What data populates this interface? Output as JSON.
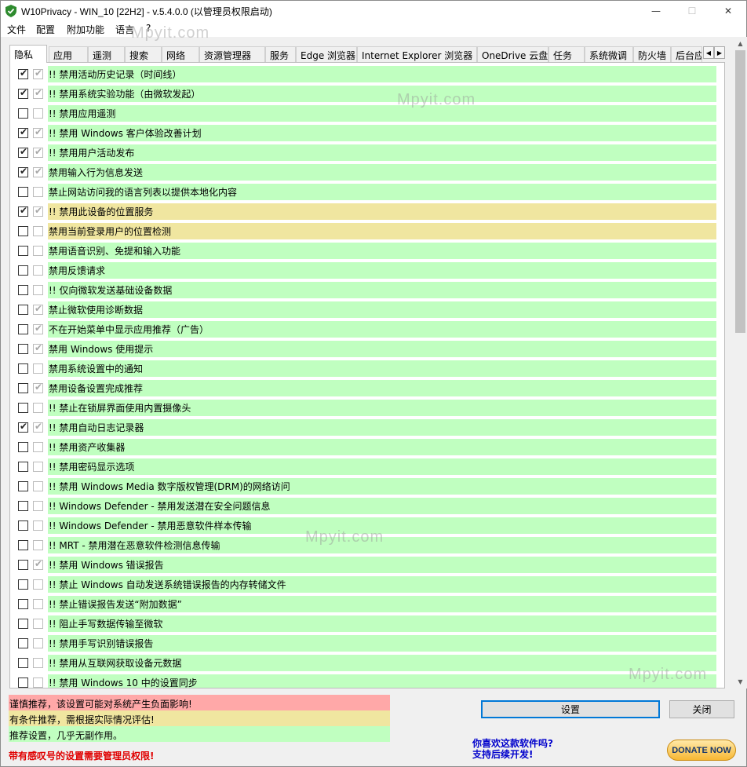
{
  "window": {
    "title": "W10Privacy - WIN_10 [22H2]  - v.5.4.0.0 (以管理员权限启动)",
    "minimize": "—",
    "maximize": "☐",
    "close": "✕"
  },
  "menu": [
    "文件",
    "配置",
    "附加功能",
    "语言",
    "?"
  ],
  "watermark": "Mpyit.com",
  "tabs": [
    {
      "label": "隐私",
      "active": true
    },
    {
      "label": "应用"
    },
    {
      "label": "遥测"
    },
    {
      "label": "搜索"
    },
    {
      "label": "网络"
    },
    {
      "label": "资源管理器"
    },
    {
      "label": "服务"
    },
    {
      "label": "Edge 浏览器"
    },
    {
      "label": "Internet Explorer 浏览器"
    },
    {
      "label": "OneDrive 云盘"
    },
    {
      "label": "任务"
    },
    {
      "label": "系统微调"
    },
    {
      "label": "防火墙"
    },
    {
      "label": "后台应"
    }
  ],
  "tab_scroll": {
    "left": "◀",
    "right": "▶"
  },
  "settings": [
    {
      "checked": true,
      "applied": true,
      "label": "!! 禁用活动历史记录（时间线）",
      "level": "green"
    },
    {
      "checked": true,
      "applied": true,
      "label": "!! 禁用系统实验功能（由微软发起）",
      "level": "green"
    },
    {
      "checked": false,
      "applied": false,
      "label": "!! 禁用应用遥测",
      "level": "green"
    },
    {
      "checked": true,
      "applied": true,
      "label": "!! 禁用 Windows 客户体验改善计划",
      "level": "green"
    },
    {
      "checked": true,
      "applied": true,
      "label": "!! 禁用用户活动发布",
      "level": "green"
    },
    {
      "checked": true,
      "applied": true,
      "label": "禁用输入行为信息发送",
      "level": "green"
    },
    {
      "checked": false,
      "applied": false,
      "label": "禁止网站访问我的语言列表以提供本地化内容",
      "level": "green"
    },
    {
      "checked": true,
      "applied": true,
      "label": "!! 禁用此设备的位置服务",
      "level": "yellow"
    },
    {
      "checked": false,
      "applied": false,
      "label": "禁用当前登录用户的位置检测",
      "level": "yellow"
    },
    {
      "checked": false,
      "applied": false,
      "label": "禁用语音识别、免提和输入功能",
      "level": "green"
    },
    {
      "checked": false,
      "applied": false,
      "label": "禁用反馈请求",
      "level": "green"
    },
    {
      "checked": false,
      "applied": false,
      "label": "!! 仅向微软发送基础设备数据",
      "level": "green"
    },
    {
      "checked": false,
      "applied": true,
      "label": "禁止微软使用诊断数据",
      "level": "green"
    },
    {
      "checked": false,
      "applied": true,
      "label": "不在开始菜单中显示应用推荐（广告）",
      "level": "green"
    },
    {
      "checked": false,
      "applied": true,
      "label": "禁用 Windows 使用提示",
      "level": "green"
    },
    {
      "checked": false,
      "applied": false,
      "label": "禁用系统设置中的通知",
      "level": "green"
    },
    {
      "checked": false,
      "applied": true,
      "label": "禁用设备设置完成推荐",
      "level": "green"
    },
    {
      "checked": false,
      "applied": false,
      "label": "!! 禁止在锁屏界面使用内置摄像头",
      "level": "green"
    },
    {
      "checked": true,
      "applied": true,
      "label": "!! 禁用自动日志记录器",
      "level": "green"
    },
    {
      "checked": false,
      "applied": false,
      "label": "!! 禁用资产收集器",
      "level": "green"
    },
    {
      "checked": false,
      "applied": false,
      "label": "!! 禁用密码显示选项",
      "level": "green"
    },
    {
      "checked": false,
      "applied": false,
      "label": "!! 禁用 Windows Media 数字版权管理(DRM)的网络访问",
      "level": "green"
    },
    {
      "checked": false,
      "applied": false,
      "label": "!! Windows Defender - 禁用发送潜在安全问题信息",
      "level": "green"
    },
    {
      "checked": false,
      "applied": false,
      "label": "!! Windows Defender - 禁用恶意软件样本传输",
      "level": "green"
    },
    {
      "checked": false,
      "applied": false,
      "label": "!! MRT - 禁用潜在恶意软件检测信息传输",
      "level": "green"
    },
    {
      "checked": false,
      "applied": true,
      "label": "!! 禁用 Windows 错误报告",
      "level": "green"
    },
    {
      "checked": false,
      "applied": false,
      "label": "!! 禁止 Windows 自动发送系统错误报告的内存转储文件",
      "level": "green"
    },
    {
      "checked": false,
      "applied": false,
      "label": "!! 禁止错误报告发送“附加数据”",
      "level": "green"
    },
    {
      "checked": false,
      "applied": false,
      "label": "!! 阻止手写数据传输至微软",
      "level": "green"
    },
    {
      "checked": false,
      "applied": false,
      "label": "!! 禁用手写识别错误报告",
      "level": "green"
    },
    {
      "checked": false,
      "applied": false,
      "label": "!! 禁用从互联网获取设备元数据",
      "level": "green"
    },
    {
      "checked": false,
      "applied": false,
      "label": "!! 禁用 Windows 10 中的设置同步",
      "level": "green"
    }
  ],
  "legend": {
    "red": "谨慎推荐，该设置可能对系统产生负面影响!",
    "yellow": "有条件推荐，需根据实际情况评估!",
    "green": "推荐设置，几乎无副作用。"
  },
  "buttons": {
    "apply": "设置",
    "close": "关闭"
  },
  "footer": {
    "admin_warning": "带有感叹号的设置需要管理员权限!",
    "support_line1": "你喜欢这款软件吗?",
    "support_line2": "支持后续开发!",
    "donate": "DONATE NOW"
  },
  "colors": {
    "green": "#c0ffc0",
    "yellow": "#f0e6a0",
    "red": "#ffa8a8",
    "accent": "#0078d7"
  },
  "icons": {
    "app": "shield-check-icon",
    "check": "check-mark-icon"
  }
}
